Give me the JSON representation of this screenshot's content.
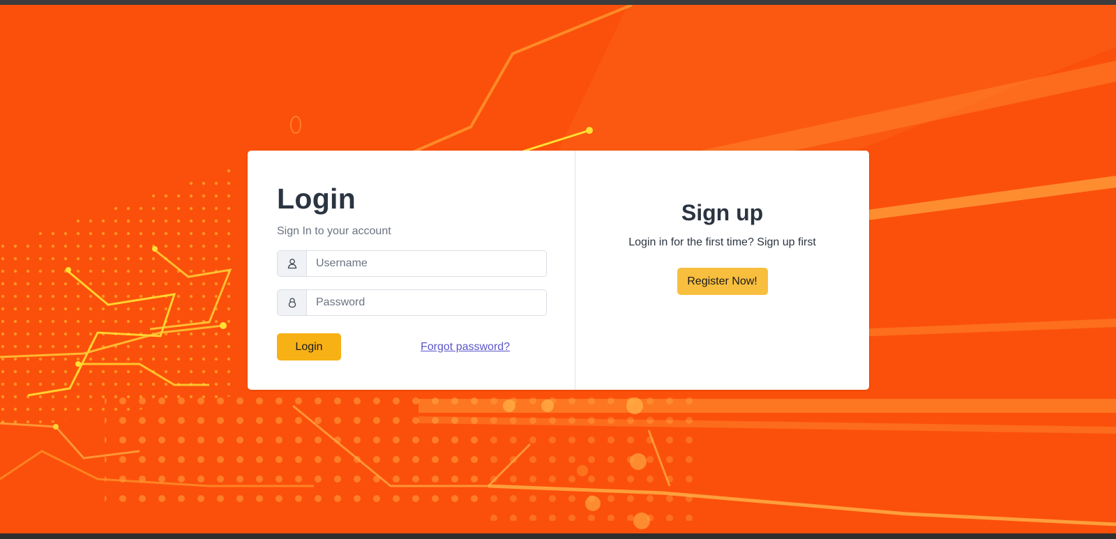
{
  "login": {
    "title": "Login",
    "subtitle": "Sign In to your account",
    "username_placeholder": "Username",
    "password_placeholder": "Password",
    "submit_label": "Login",
    "forgot_label": "Forgot password?",
    "username_icon": "user-icon",
    "password_icon": "lock-icon"
  },
  "signup": {
    "title": "Sign up",
    "text": "Login in for the first time? Sign up first",
    "register_label": "Register Now!"
  },
  "colors": {
    "background": "#fb500b",
    "login_button": "#f7b115",
    "register_button": "#f8be3e",
    "link": "#5a55c8"
  }
}
